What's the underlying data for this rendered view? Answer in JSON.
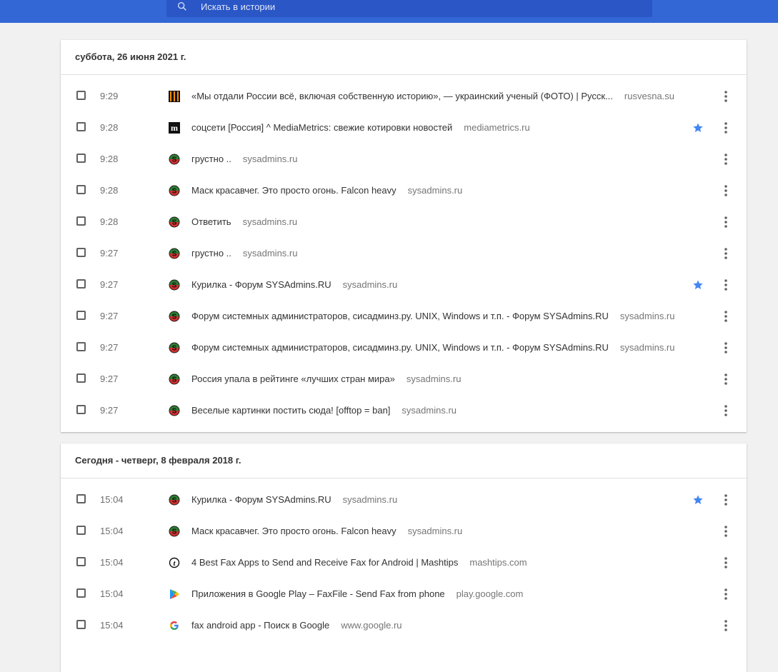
{
  "search": {
    "placeholder": "Искать в истории"
  },
  "colors": {
    "accent": "#3367d6",
    "star": "#4285f4"
  },
  "groups": [
    {
      "header": "суббота, 26 июня 2021 г.",
      "items": [
        {
          "time": "9:29",
          "title": "«Мы отдали России всё, включая собственную историю», — украинский ученый (ФОТО) | Русск...",
          "domain": "rusvesna.su",
          "icon": "rusvesna-icon",
          "starred": false
        },
        {
          "time": "9:28",
          "title": "соцсети [Россия] ^ MediaMetrics: свежие котировки новостей",
          "domain": "mediametrics.ru",
          "icon": "mediametrics-icon",
          "starred": true
        },
        {
          "time": "9:28",
          "title": "грустно ..",
          "domain": "sysadmins.ru",
          "icon": "sysadmins-icon",
          "starred": false
        },
        {
          "time": "9:28",
          "title": "Маск красавчег. Это просто огонь. Falcon heavy",
          "domain": "sysadmins.ru",
          "icon": "sysadmins-icon",
          "starred": false
        },
        {
          "time": "9:28",
          "title": "Ответить",
          "domain": "sysadmins.ru",
          "icon": "sysadmins-icon",
          "starred": false
        },
        {
          "time": "9:27",
          "title": "грустно ..",
          "domain": "sysadmins.ru",
          "icon": "sysadmins-icon",
          "starred": false
        },
        {
          "time": "9:27",
          "title": "Курилка - Форум SYSAdmins.RU",
          "domain": "sysadmins.ru",
          "icon": "sysadmins-icon",
          "starred": true
        },
        {
          "time": "9:27",
          "title": "Форум системных администраторов, сисадминз.ру. UNIX, Windows и т.п. - Форум SYSAdmins.RU",
          "domain": "sysadmins.ru",
          "icon": "sysadmins-icon",
          "starred": false
        },
        {
          "time": "9:27",
          "title": "Форум системных администраторов, сисадминз.ру. UNIX, Windows и т.п. - Форум SYSAdmins.RU",
          "domain": "sysadmins.ru",
          "icon": "sysadmins-icon",
          "starred": false
        },
        {
          "time": "9:27",
          "title": "Россия упала в рейтинге «лучших стран мира»",
          "domain": "sysadmins.ru",
          "icon": "sysadmins-icon",
          "starred": false
        },
        {
          "time": "9:27",
          "title": "Веселые картинки постить сюда! [offtop = ban]",
          "domain": "sysadmins.ru",
          "icon": "sysadmins-icon",
          "starred": false
        }
      ]
    },
    {
      "header": "Сегодня - четверг, 8 февраля 2018 г.",
      "items": [
        {
          "time": "15:04",
          "title": "Курилка - Форум SYSAdmins.RU",
          "domain": "sysadmins.ru",
          "icon": "sysadmins-icon",
          "starred": true
        },
        {
          "time": "15:04",
          "title": "Маск красавчег. Это просто огонь. Falcon heavy",
          "domain": "sysadmins.ru",
          "icon": "sysadmins-icon",
          "starred": false
        },
        {
          "time": "15:04",
          "title": "4 Best Fax Apps to Send and Receive Fax for Android | Mashtips",
          "domain": "mashtips.com",
          "icon": "mashtips-icon",
          "starred": false
        },
        {
          "time": "15:04",
          "title": "Приложения в Google Play – FaxFile - Send Fax from phone",
          "domain": "play.google.com",
          "icon": "google-play-icon",
          "starred": false
        },
        {
          "time": "15:04",
          "title": "fax android app - Поиск в Google",
          "domain": "www.google.ru",
          "icon": "google-icon",
          "starred": false
        }
      ]
    }
  ]
}
